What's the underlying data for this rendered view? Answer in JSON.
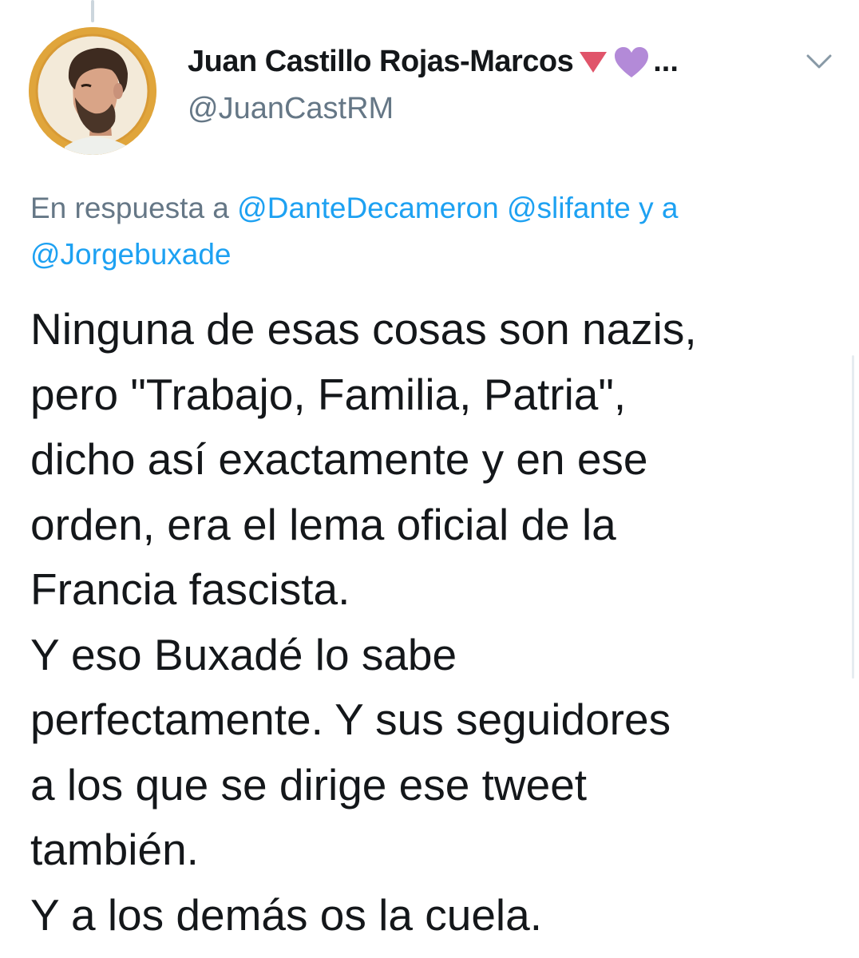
{
  "tweet": {
    "author": {
      "display_name": "Juan Castillo Rojas-Marcos",
      "name_emojis": [
        "red-down-triangle",
        "purple-heart"
      ],
      "name_truncation": "...",
      "handle": "@JuanCastRM"
    },
    "reply_to": {
      "prefix": "En respuesta a",
      "mentions": [
        "@DanteDecameron",
        "@slifante",
        "@Jorgebuxade"
      ],
      "connector": "y a"
    },
    "text_lines": [
      "Ninguna de esas cosas son nazis,",
      "pero \"Trabajo, Familia, Patria\",",
      "dicho así exactamente y en ese",
      "orden, era el lema oficial de la",
      "Francia fascista.",
      "Y eso Buxadé lo sabe",
      "perfectamente. Y sus seguidores",
      "a los que se dirige ese tweet",
      "también.",
      "Y a los demás os la cuela."
    ]
  },
  "icons": {
    "more_menu": "chevron-down-icon",
    "avatar": "user-avatar"
  },
  "colors": {
    "text_primary": "#14171a",
    "text_secondary": "#657786",
    "link": "#1da1f2",
    "avatar_ring": "#e0a53b",
    "triangle_emoji": "#e0546a",
    "heart_emoji": "#b38ad8"
  }
}
